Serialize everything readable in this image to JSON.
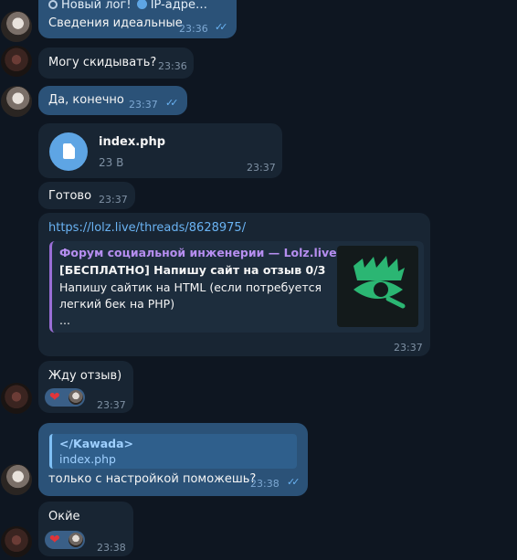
{
  "messages": {
    "m1": {
      "line1_text": "Новый лог!",
      "line1_suffix": "IP-адре…",
      "text": "Сведения идеальные",
      "time": "23:36"
    },
    "m2": {
      "text": "Могу скидывать?",
      "time": "23:36"
    },
    "m3": {
      "text": "Да, конечно",
      "time": "23:37"
    },
    "m4": {
      "file_name": "index.php",
      "file_size": "23 B",
      "time": "23:37"
    },
    "m5": {
      "text": "Готово",
      "time": "23:37"
    },
    "m6": {
      "url": "https://lolz.live/threads/8628975/",
      "preview_site": "Форум социальной инженерии — Lolz.live…",
      "preview_title": "[БЕСПЛАТНО] Напишу сайт на отзыв 0/3",
      "preview_line1": "Напишу сайтик на HTML (если потребуется",
      "preview_line2": "легкий бек на PHP)",
      "preview_line3": "...",
      "time": "23:37"
    },
    "m7": {
      "text": "Жду отзыв)",
      "time": "23:37",
      "reaction": "❤"
    },
    "m8": {
      "reply_name": "</Kawada>",
      "reply_text": "index.php",
      "text": "только с настройкой поможешь?",
      "time": "23:38"
    },
    "m9": {
      "text": "Окйе",
      "time": "23:38",
      "reaction": "❤"
    }
  },
  "colors": {
    "background": "#0e1621",
    "outgoing_bubble": "#2b5278",
    "incoming_bubble": "#182533",
    "accent": "#6ab3f3",
    "preview_accent": "#9a6ed6",
    "logo_green": "#2bb673"
  },
  "icons": [
    "avatar",
    "search-icon",
    "globe-icon",
    "double-check-icon",
    "file-icon",
    "heart-icon",
    "lolz-logo"
  ]
}
